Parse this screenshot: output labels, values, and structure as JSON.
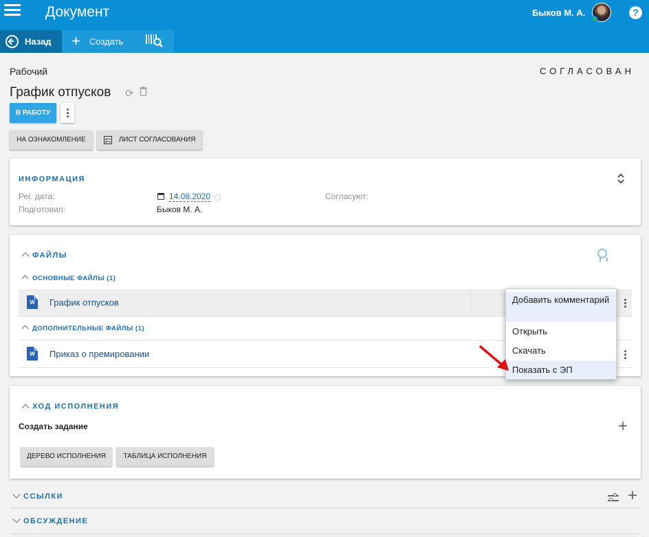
{
  "header": {
    "title": "Документ",
    "user_name": "Быков М. А.",
    "help": "?"
  },
  "toolbar": {
    "back_label": "Назад",
    "create_label": "Создать"
  },
  "document": {
    "state": "Рабочий",
    "status": "СОГЛАСОВАН",
    "title": "График отпусков",
    "primary_action": "В РАБОТУ",
    "familiarize_label": "НА ОЗНАКОМЛЕНИЕ",
    "approval_sheet_label": "ЛИСТ СОГЛАСОВАНИЯ"
  },
  "info": {
    "title": "ИНФОРМАЦИЯ",
    "reg_date_label": "Рег. дата:",
    "reg_date_value": "14.08.2020",
    "prepared_label": "Подготовил:",
    "prepared_value": "Быков М. А.",
    "approvers_label": "Согласуют:"
  },
  "files": {
    "title": "ФАЙЛЫ",
    "main_title": "ОСНОВНЫЕ ФАЙЛЫ (1)",
    "main_files": [
      {
        "name": "График отпусков",
        "type_icon": "W"
      }
    ],
    "extra_title": "ДОПОЛНИТЕЛЬНЫЕ ФАЙЛЫ (1)",
    "extra_files": [
      {
        "name": "Приказ о премировании",
        "type_icon": "W"
      }
    ]
  },
  "context_menu": {
    "items": [
      "Добавить комментарий",
      "Открыть",
      "Скачать",
      "Показать с ЭП"
    ]
  },
  "execution": {
    "title": "ХОД ИСПОЛНЕНИЯ",
    "create_task": "Создать задание",
    "tree_label": "ДЕРЕВО ИСПОЛНЕНИЯ",
    "table_label": "ТАБЛИЦА ИСПОЛНЕНИЯ"
  },
  "links": {
    "title": "ССЫЛКИ"
  },
  "discussion": {
    "title": "ОБСУЖДЕНИЕ"
  },
  "colors": {
    "primary": "#0a8fd6",
    "toolbar_active": "#0b6fa5",
    "accent_text": "#1a6fb5",
    "status_online": "#35c04a",
    "annotation_arrow": "#e01010"
  }
}
